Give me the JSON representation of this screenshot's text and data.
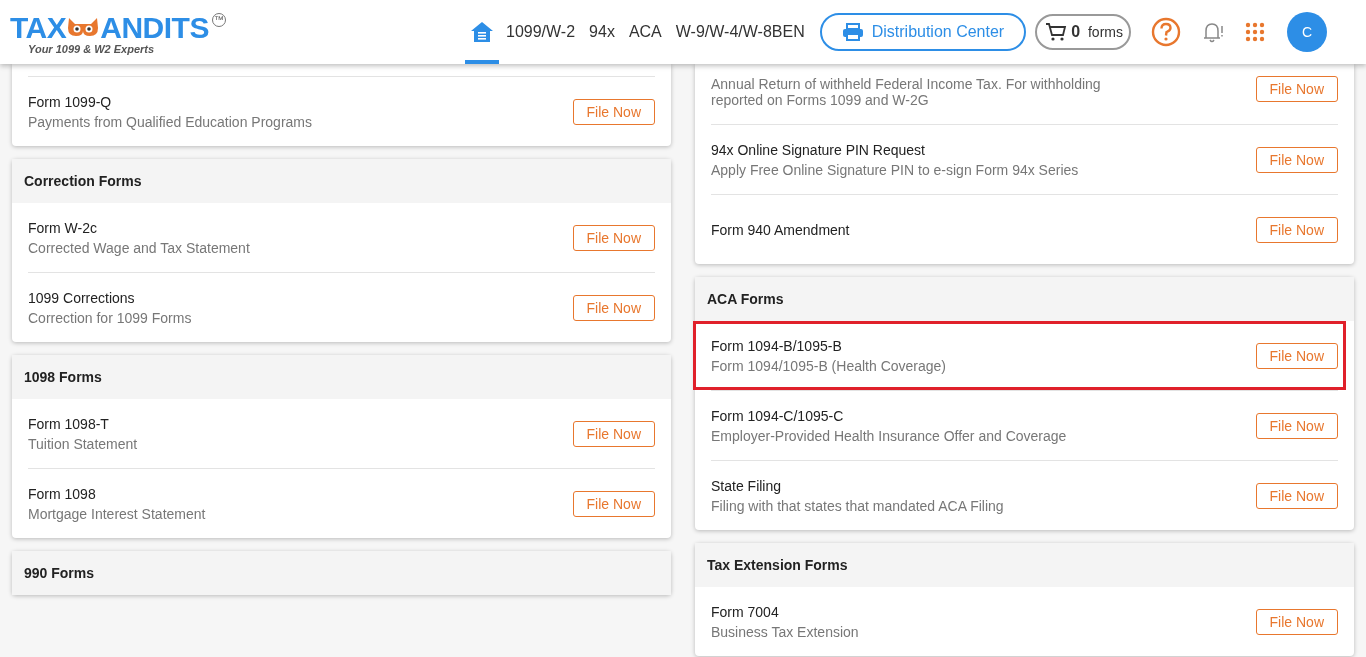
{
  "logo": {
    "left": "TAX",
    "right": "ANDITS",
    "mark": "™",
    "tagline": "Your 1099 & W2 Experts"
  },
  "nav": [
    {
      "kind": "home",
      "selected": true
    },
    {
      "kind": "text",
      "label": "1099/W-2",
      "selected": false
    },
    {
      "kind": "text",
      "label": "94x",
      "selected": false
    },
    {
      "kind": "text",
      "label": "ACA",
      "selected": false
    },
    {
      "kind": "text",
      "label": "W-9/W-4/W-8BEN",
      "selected": false
    }
  ],
  "distribution_button": "Distribution Center",
  "cart": {
    "count": "0",
    "label": "forms"
  },
  "avatar": "C",
  "left_column": [
    {
      "rows": [
        {
          "name": "Form 1099-Q",
          "description": "Payments from Qualified Education Programs",
          "button": "File Now",
          "highlight": false
        }
      ]
    },
    {
      "title": "Correction Forms",
      "rows": [
        {
          "name": "Form W-2c",
          "description": "Corrected Wage and Tax Statement",
          "button": "File Now",
          "highlight": false
        },
        {
          "name": "1099 Corrections",
          "description": "Correction for 1099 Forms",
          "button": "File Now",
          "highlight": false
        }
      ]
    },
    {
      "title": "1098 Forms",
      "rows": [
        {
          "name": "Form 1098-T",
          "description": "Tuition Statement",
          "button": "File Now",
          "highlight": false
        },
        {
          "name": "Form 1098",
          "description": "Mortgage Interest Statement",
          "button": "File Now",
          "highlight": false
        }
      ]
    },
    {
      "title": "990 Forms"
    }
  ],
  "right_column": [
    {
      "rows": [
        {
          "description": "Annual Return of withheld Federal Income Tax. For withholding reported on Forms 1099 and W-2G",
          "button": "File Now",
          "highlight": false
        },
        {
          "name": "94x Online Signature PIN Request",
          "description": "Apply Free Online Signature PIN to e-sign Form 94x Series",
          "button": "File Now",
          "highlight": false
        },
        {
          "name": "Form 940 Amendment",
          "button": "File Now",
          "highlight": false
        }
      ]
    },
    {
      "title": "ACA Forms",
      "rows": [
        {
          "name": "Form 1094-B/1095-B",
          "description": "Form 1094/1095-B (Health Coverage)",
          "button": "File Now",
          "highlight": true
        },
        {
          "name": "Form 1094-C/1095-C",
          "description": "Employer-Provided Health Insurance Offer and Coverage",
          "button": "File Now",
          "highlight": false
        },
        {
          "name": "State Filing",
          "description": "Filing with that states that mandated ACA Filing",
          "button": "File Now",
          "highlight": false
        }
      ]
    },
    {
      "title": "Tax Extension Forms",
      "rows": [
        {
          "name": "Form 7004",
          "description": "Business Tax Extension",
          "button": "File Now",
          "highlight": false
        }
      ]
    }
  ]
}
